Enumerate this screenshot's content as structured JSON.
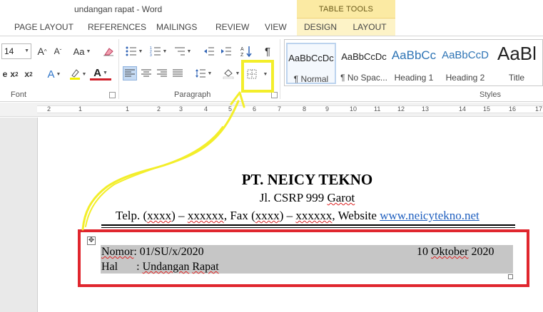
{
  "window": {
    "title": "undangan rapat - Word",
    "contextual_header": "TABLE TOOLS"
  },
  "tabs": [
    {
      "label": "PAGE LAYOUT"
    },
    {
      "label": "REFERENCES"
    },
    {
      "label": "MAILINGS"
    },
    {
      "label": "REVIEW"
    },
    {
      "label": "VIEW"
    },
    {
      "label": "DESIGN"
    },
    {
      "label": "LAYOUT"
    }
  ],
  "ribbon": {
    "font_group_label": "Font",
    "paragraph_group_label": "Paragraph",
    "styles_group_label": "Styles",
    "font_size": "14",
    "grow_font": "A",
    "shrink_font": "A",
    "change_case": "Aa",
    "subscript": "x",
    "superscript": "x",
    "strike": "e",
    "text_effects": "A",
    "font_color": "A",
    "pilcrow": "¶",
    "styles": [
      {
        "preview": "AaBbCcDc",
        "name": "¶ Normal"
      },
      {
        "preview": "AaBbCcDc",
        "name": "¶ No Spac..."
      },
      {
        "preview": "AaBbCc",
        "name": "Heading 1"
      },
      {
        "preview": "AaBbCcD",
        "name": "Heading 2"
      },
      {
        "preview": "AaBl",
        "name": "Title"
      }
    ]
  },
  "ruler": {
    "marks": [
      "2",
      "1",
      "1",
      "2",
      "3",
      "4",
      "5",
      "6",
      "7",
      "8",
      "9",
      "10",
      "11",
      "12",
      "13",
      "14",
      "15",
      "16",
      "17"
    ]
  },
  "document": {
    "company": "PT. NEICY TEKNO",
    "address_prefix": "Jl. CSRP 999 ",
    "address_city": "Garot",
    "contact": {
      "telp_label": "Telp. (",
      "telp_code": "xxxx",
      "telp_mid": ") – ",
      "telp_num": "xxxxxx",
      "fax_label": ", Fax (",
      "fax_code": "xxxx",
      "fax_mid": ") – ",
      "fax_num": "xxxxxx",
      "website_label": ", Website ",
      "website": "www.neicytekno.net"
    },
    "letter_table": {
      "nomor_label": "Nomor",
      "nomor_value": ": 01/SU/x/2020",
      "date_day": "10 ",
      "date_month": "Oktober",
      "date_year": " 2020",
      "hal_label": "Hal",
      "hal_sep": ": ",
      "hal_value_1": "Undangan",
      "hal_value_2": " ",
      "hal_value_3": "Rapat"
    }
  },
  "annotation_colors": {
    "highlight_box": "#f3ee2a",
    "selection_box": "#e0262e",
    "selection_fill": "#c6c6c6"
  }
}
